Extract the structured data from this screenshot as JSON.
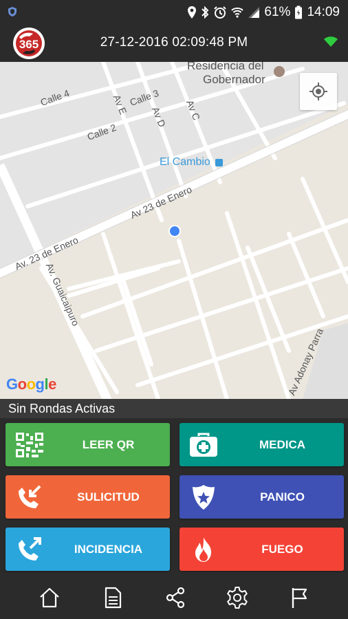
{
  "status_bar": {
    "battery": "61%",
    "time": "14:09"
  },
  "header": {
    "datetime": "27-12-2016  02:09:48 PM",
    "logo_icon": "365-logo-icon",
    "wifi_color": "#2ecc40"
  },
  "map": {
    "labels": {
      "residencia": "Residencia del",
      "gobernador": "Gobernador",
      "calle4": "Calle 4",
      "calle3": "Calle 3",
      "calle2": "Calle 2",
      "ave": "Av E",
      "avd": "Av D",
      "avc": "Av C",
      "elcambio": "El Cambio",
      "av23a": "Av 23 de Enero",
      "av23b": "Av. 23 de Enero",
      "guaicaipuro": "Av. Guaicaipuro",
      "adonay": "Av Adonay Parra"
    },
    "google": [
      "G",
      "o",
      "o",
      "g",
      "l",
      "e"
    ],
    "google_colors": [
      "#4285f4",
      "#ea4335",
      "#fbbc05",
      "#4285f4",
      "#34a853",
      "#ea4335"
    ]
  },
  "ronda_status": "Sin Rondas Activas",
  "actions": {
    "leer_qr": {
      "label": "LEER QR",
      "color": "#4caf50",
      "icon": "qr-code-icon"
    },
    "medica": {
      "label": "MEDICA",
      "color": "#009688",
      "icon": "first-aid-kit-icon"
    },
    "sulicitud": {
      "label": "SULICITUD",
      "color": "#f0663a",
      "icon": "phone-incoming-icon"
    },
    "panico": {
      "label": "PANICO",
      "color": "#3f51b5",
      "icon": "police-badge-icon"
    },
    "incidencia": {
      "label": "INCIDENCIA",
      "color": "#2ba6dc",
      "icon": "phone-outgoing-icon"
    },
    "fuego": {
      "label": "FUEGO",
      "color": "#f44336",
      "icon": "fire-icon"
    }
  },
  "nav": [
    "home-icon",
    "document-icon",
    "share-icon",
    "settings-icon",
    "flag-icon"
  ]
}
